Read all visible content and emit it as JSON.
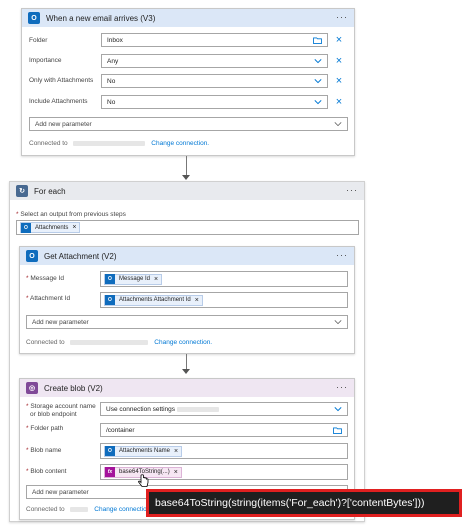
{
  "email_card": {
    "title": "When a new email arrives (V3)",
    "more": "···",
    "icon": "outlook-icon",
    "fields": [
      {
        "label": "Folder",
        "value": "Inbox",
        "control": "folder-picker"
      },
      {
        "label": "Importance",
        "value": "Any",
        "control": "dropdown"
      },
      {
        "label": "Only with Attachments",
        "value": "No",
        "control": "dropdown"
      },
      {
        "label": "Include Attachments",
        "value": "No",
        "control": "dropdown"
      }
    ],
    "add_param": "Add new parameter",
    "connected": "Connected to",
    "change_connection": "Change connection."
  },
  "foreach_card": {
    "title": "For each",
    "more": "···",
    "select_label": "Select an output from previous steps",
    "token": "Attachments"
  },
  "attachment_card": {
    "title": "Get Attachment (V2)",
    "more": "···",
    "fields": [
      {
        "label": "Message Id",
        "token": "Message Id"
      },
      {
        "label": "Attachment Id",
        "token": "Attachments Attachment Id"
      }
    ],
    "add_param": "Add new parameter",
    "connected": "Connected to",
    "change_connection": "Change connection."
  },
  "blob_card": {
    "title": "Create blob (V2)",
    "more": "···",
    "storage_label_line1": "Storage account name",
    "storage_label_line2": "or blob endpoint",
    "storage_value": "Use connection settings",
    "folder_label": "Folder path",
    "folder_value": "/container",
    "blobname_label": "Blob name",
    "blobname_token": "Attachments Name",
    "blobcontent_label": "Blob content",
    "blobcontent_token": "base64ToString(...)",
    "add_param": "Add new parameter",
    "connected": "Connected to",
    "change_connection": "Change connection."
  },
  "tooltip": "base64ToString(string(items('For_each')?['contentBytes']))",
  "colors": {
    "trigger_header": "#dbe7f7",
    "outlook_blue": "#0f6cbd",
    "foreach_header": "#e8eaee",
    "foreach_icon": "#486991",
    "blob_header": "#efe6f2",
    "blob_icon": "#804998",
    "expression_icon": "#a4139b"
  }
}
